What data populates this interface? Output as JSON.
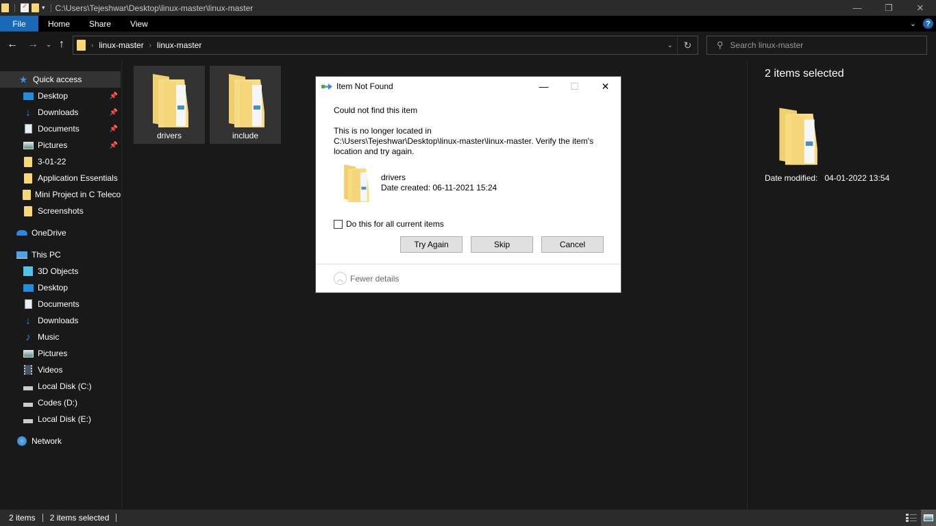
{
  "window": {
    "title": "C:\\Users\\Tejeshwar\\Desktop\\linux-master\\linux-master",
    "controls": {
      "minimize": "—",
      "restore": "❐",
      "close": "✕"
    }
  },
  "ribbon": {
    "tabs": [
      {
        "label": "File"
      },
      {
        "label": "Home"
      },
      {
        "label": "Share"
      },
      {
        "label": "View"
      }
    ],
    "help": "?",
    "accent": "#1a69b8"
  },
  "nav": {
    "breadcrumb": [
      "linux-master",
      "linux-master"
    ],
    "search_placeholder": "Search linux-master"
  },
  "sidebar": {
    "quick_access": {
      "label": "Quick access"
    },
    "quick_items": [
      {
        "label": "Desktop",
        "icon": "desktop-icon",
        "pinned": true
      },
      {
        "label": "Downloads",
        "icon": "downloads-icon",
        "pinned": true
      },
      {
        "label": "Documents",
        "icon": "documents-icon",
        "pinned": true
      },
      {
        "label": "Pictures",
        "icon": "pictures-icon",
        "pinned": true
      },
      {
        "label": "3-01-22",
        "icon": "folder-icon",
        "pinned": false
      },
      {
        "label": "Application Essentials",
        "icon": "folder-icon",
        "pinned": false
      },
      {
        "label": "Mini Project in C Teleco",
        "icon": "folder-icon",
        "pinned": false
      },
      {
        "label": "Screenshots",
        "icon": "folder-icon",
        "pinned": false
      }
    ],
    "onedrive": {
      "label": "OneDrive"
    },
    "this_pc": {
      "label": "This PC"
    },
    "pc_items": [
      {
        "label": "3D Objects",
        "icon": "3d-objects-icon"
      },
      {
        "label": "Desktop",
        "icon": "desktop-icon"
      },
      {
        "label": "Documents",
        "icon": "documents-icon"
      },
      {
        "label": "Downloads",
        "icon": "downloads-icon"
      },
      {
        "label": "Music",
        "icon": "music-icon"
      },
      {
        "label": "Pictures",
        "icon": "pictures-icon"
      },
      {
        "label": "Videos",
        "icon": "videos-icon"
      },
      {
        "label": "Local Disk (C:)",
        "icon": "drive-icon"
      },
      {
        "label": "Codes (D:)",
        "icon": "drive-icon"
      },
      {
        "label": "Local Disk (E:)",
        "icon": "drive-icon"
      }
    ],
    "network": {
      "label": "Network"
    }
  },
  "content": {
    "items": [
      {
        "name": "drivers",
        "selected": true
      },
      {
        "name": "include",
        "selected": true
      }
    ]
  },
  "details_pane": {
    "title": "2 items selected",
    "date_modified_label": "Date modified:",
    "date_modified_value": "04-01-2022 13:54"
  },
  "status": {
    "item_count": "2 items",
    "selected_count": "2 items selected"
  },
  "dialog": {
    "title": "Item Not Found",
    "heading": "Could not find this item",
    "message_line1": "This is no longer located in",
    "message_line2": "C:\\Users\\Tejeshwar\\Desktop\\linux-master\\linux-master. Verify the item's location and try again.",
    "item_name": "drivers",
    "item_date": "Date created: 06-11-2021 15:24",
    "checkbox_label": "Do this for all current items",
    "checkbox_checked": false,
    "buttons": {
      "try_again": "Try Again",
      "skip": "Skip",
      "cancel": "Cancel"
    },
    "fewer_details": "Fewer details",
    "controls": {
      "minimize": "—",
      "maximize": "☐",
      "close": "✕"
    }
  }
}
